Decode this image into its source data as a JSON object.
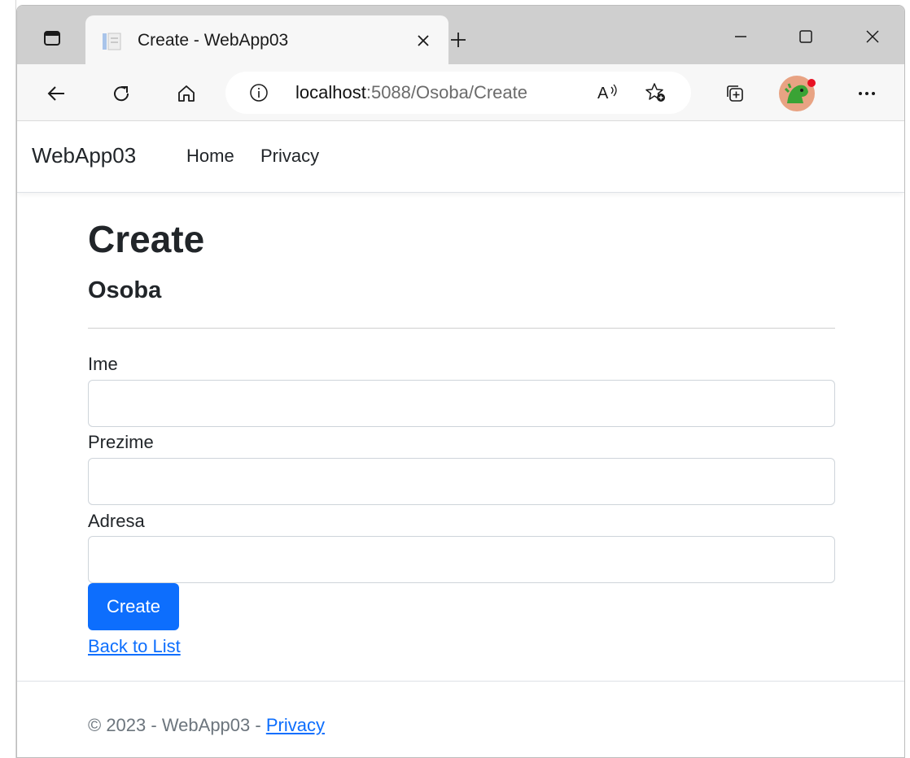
{
  "browser": {
    "tab_title": "Create - WebApp03",
    "url_host": "localhost",
    "url_rest": ":5088/Osoba/Create"
  },
  "site": {
    "brand": "WebApp03",
    "nav": [
      "Home",
      "Privacy"
    ]
  },
  "form": {
    "heading": "Create",
    "subheading": "Osoba",
    "fields": [
      {
        "label": "Ime",
        "value": ""
      },
      {
        "label": "Prezime",
        "value": ""
      },
      {
        "label": "Adresa",
        "value": ""
      }
    ],
    "submit_label": "Create",
    "back_link": "Back to List"
  },
  "footer": {
    "text": "© 2023 - WebApp03 - ",
    "privacy_link": "Privacy"
  },
  "colors": {
    "primary": "#0d6efd",
    "tabbar": "#cfcfcf",
    "toolbar": "#f7f7f7",
    "notification_dot": "#e81123"
  },
  "icons": [
    "tab-actions-icon",
    "page-favicon-icon",
    "close-tab-icon",
    "new-tab-icon",
    "minimize-icon",
    "maximize-icon",
    "close-window-icon",
    "back-arrow-icon",
    "refresh-icon",
    "home-icon",
    "site-info-icon",
    "read-aloud-icon",
    "add-favorite-icon",
    "collections-icon",
    "profile-avatar",
    "more-options-icon"
  ]
}
